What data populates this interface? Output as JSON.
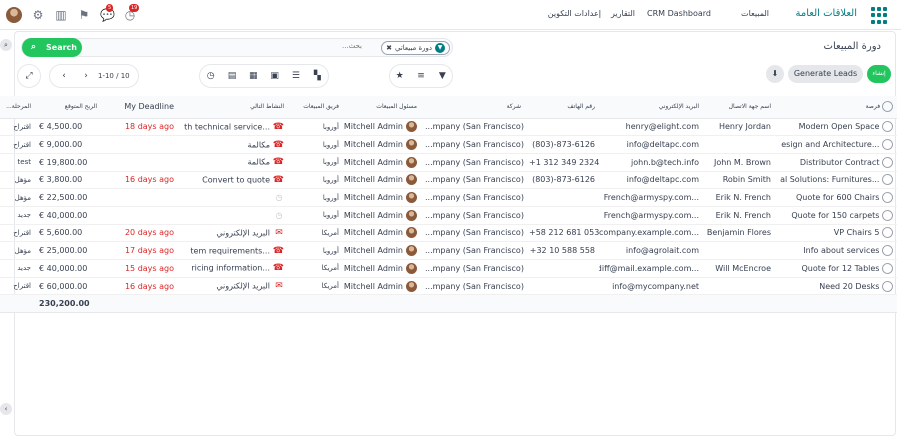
{
  "topbar": {
    "brand": "العلاقات العامة",
    "menu": [
      "المبيعات",
      "CRM Dashboard",
      "التقارير",
      "إعدادات التكوين"
    ],
    "badges": {
      "messages": "5",
      "activities": "19"
    }
  },
  "page": {
    "title": "دورة المبيعات",
    "search_button": "Search",
    "facet": "دورة مبيعاتي",
    "search_placeholder": "بحث...",
    "new_button": "إنشاء",
    "generate_leads": "Generate Leads",
    "pager": "1-10 / 10"
  },
  "table": {
    "columns": [
      "فرصة",
      "اسم جهة الاتصال",
      "البريد الإلكتروني",
      "رقم الهاتف",
      "شركة",
      "مسئول المبيعات",
      "فريق المبيعات",
      "النشاط التالي",
      "My Deadline",
      "الربح المتوقع",
      "المرحلة..."
    ],
    "rows": [
      {
        "opportunity": "Modern Open Space",
        "contact": "Henry Jordan",
        "email": "henry@elight.com",
        "phone": "",
        "company": "...mpany (San Francisco)",
        "salesperson": "Mitchell Admin",
        "team": "أوروبا",
        "activity_icon": "phone",
        "activity": "...th technical service",
        "deadline": "18 days ago",
        "revenue": "€ 4,500.00",
        "stage": "اقتراح"
      },
      {
        "opportunity": "...esign and Architecture",
        "contact": "",
        "email": "info@deltapc.com",
        "phone": "(803)-873-6126",
        "company": "...mpany (San Francisco)",
        "salesperson": "Mitchell Admin",
        "team": "أوروبا",
        "activity_icon": "phone",
        "activity": "مكالمة",
        "deadline": "",
        "revenue": "€ 9,000.00",
        "stage": "اقتراح"
      },
      {
        "opportunity": "Distributor Contract",
        "contact": "John M. Brown",
        "email": "john.b@tech.info",
        "phone": "+1 312 349 2324",
        "company": "...mpany (San Francisco)",
        "salesperson": "Mitchell Admin",
        "team": "أوروبا",
        "activity_icon": "phone",
        "activity": "مكالمة",
        "deadline": "",
        "revenue": "€ 19,800.00",
        "stage": "test"
      },
      {
        "opportunity": "...al Solutions: Furnitures",
        "contact": "Robin Smith",
        "email": "info@deltapc.com",
        "phone": "(803)-873-6126",
        "company": "...mpany (San Francisco)",
        "salesperson": "Mitchell Admin",
        "team": "أوروبا",
        "activity_icon": "phone",
        "activity": "Convert to quote",
        "deadline": "16 days ago",
        "revenue": "€ 3,800.00",
        "stage": "مؤهل"
      },
      {
        "opportunity": "Quote for 600 Chairs",
        "contact": "Erik N. French",
        "email": "...French@armyspy.com",
        "phone": "",
        "company": "...mpany (San Francisco)",
        "salesperson": "Mitchell Admin",
        "team": "أوروبا",
        "activity_icon": "clock",
        "activity": "",
        "deadline": "",
        "revenue": "€ 22,500.00",
        "stage": "مؤهل"
      },
      {
        "opportunity": "Quote for 150 carpets",
        "contact": "Erik N. French",
        "email": "...French@armyspy.com",
        "phone": "",
        "company": "...mpany (San Francisco)",
        "salesperson": "Mitchell Admin",
        "team": "أوروبا",
        "activity_icon": "clock",
        "activity": "",
        "deadline": "",
        "revenue": "€ 40,000.00",
        "stage": "جديد"
      },
      {
        "opportunity": "VP Chairs 5",
        "contact": "Benjamin Flores",
        "email": "...company.example.com",
        "phone": "+58 212 681 0538",
        "company": "...mpany (San Francisco)",
        "salesperson": "Mitchell Admin",
        "team": "أمريكا",
        "activity_icon": "email",
        "activity": "البريد الإلكتروني",
        "deadline": "20 days ago",
        "revenue": "€ 5,600.00",
        "stage": "اقتراح"
      },
      {
        "opportunity": "Info about services",
        "contact": "",
        "email": "info@agrolait.com",
        "phone": "+32 10 588 558",
        "company": "...mpany (San Francisco)",
        "salesperson": "Mitchell Admin",
        "team": "أوروبا",
        "activity_icon": "phone",
        "activity": "...tem requirements",
        "deadline": "17 days ago",
        "revenue": "€ 25,000.00",
        "stage": "مؤهل"
      },
      {
        "opportunity": "Quote for 12 Tables",
        "contact": "Will McEncroe",
        "email": "...ediff@mail.example.com",
        "phone": "",
        "company": "...mpany (San Francisco)",
        "salesperson": "Mitchell Admin",
        "team": "أمريكا",
        "activity_icon": "phone",
        "activity": "...ricing information",
        "deadline": "15 days ago",
        "revenue": "€ 40,000.00",
        "stage": "جديد"
      },
      {
        "opportunity": "Need 20 Desks",
        "contact": "",
        "email": "info@mycompany.net",
        "phone": "",
        "company": "...mpany (San Francisco)",
        "salesperson": "Mitchell Admin",
        "team": "أمريكا",
        "activity_icon": "email",
        "activity": "البريد الإلكتروني",
        "deadline": "16 days ago",
        "revenue": "€ 60,000.00",
        "stage": "اقتراح"
      }
    ],
    "total_revenue": "230,200.00"
  },
  "colors": {
    "primary": "#017e84",
    "accent": "#22c55e",
    "danger": "#dc2626"
  }
}
